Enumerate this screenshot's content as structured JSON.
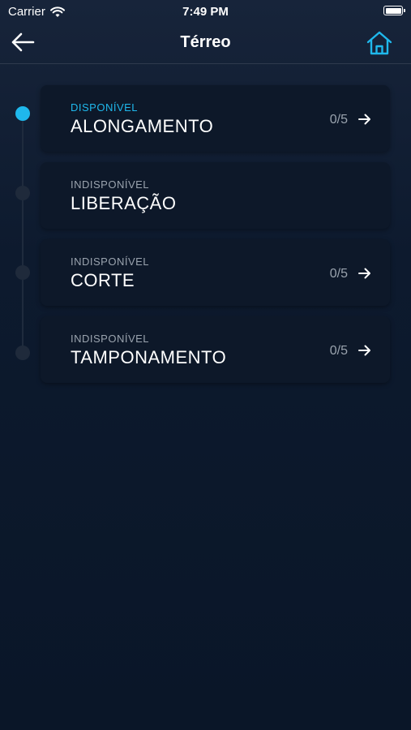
{
  "status_bar": {
    "carrier": "Carrier",
    "time": "7:49 PM",
    "wifi_icon": "wifi-icon",
    "battery_icon": "battery-icon"
  },
  "nav": {
    "title": "Térreo",
    "back_icon": "arrow-left-icon",
    "home_icon": "home-icon"
  },
  "colors": {
    "accent": "#1fb8ec",
    "background": "#0a1628",
    "card": "#0d1829",
    "muted_text": "#9aa3ae"
  },
  "steps": [
    {
      "status": "DISPONÍVEL",
      "title": "ALONGAMENTO",
      "count": "0/5",
      "state": "available"
    },
    {
      "status": "INDISPONÍVEL",
      "title": "LIBERAÇÃO",
      "count": "",
      "state": "unavailable"
    },
    {
      "status": "INDISPONÍVEL",
      "title": "CORTE",
      "count": "0/5",
      "state": "unavailable"
    },
    {
      "status": "INDISPONÍVEL",
      "title": "TAMPONAMENTO",
      "count": "0/5",
      "state": "unavailable"
    }
  ]
}
